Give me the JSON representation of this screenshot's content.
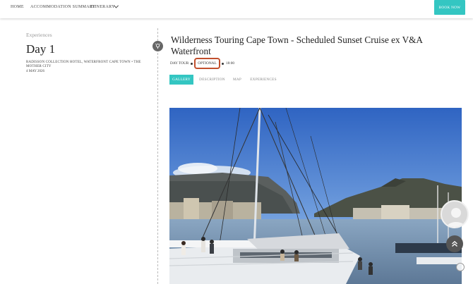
{
  "nav": {
    "home": "HOME",
    "accommodation": "ACCOMMODATION SUMMARY",
    "itinerary": "ITINERARY",
    "book_now": "BOOK NOW"
  },
  "left": {
    "section_label": "Experiences",
    "day_title": "Day 1",
    "hotel": "RADISSON COLLECTION HOTEL, WATERFRONT CAPE TOWN • THE MOTHER CITY",
    "date": "4 MAY 2026"
  },
  "event": {
    "title": "Wilderness Touring Cape Town - Scheduled Sunset Cruise ex V&A Waterfront",
    "type": "DAY TOUR",
    "optional": "OPTIONAL",
    "time": "18:00"
  },
  "tabs": [
    {
      "label": "GALLERY",
      "active": true
    },
    {
      "label": "DESCRIPTION",
      "active": false
    },
    {
      "label": "MAP",
      "active": false
    },
    {
      "label": "EXPERIENCES",
      "active": false
    }
  ],
  "colors": {
    "accent": "#34c6c2",
    "highlight_border": "#c1502e"
  },
  "icons": {
    "timeline": "map-pin-icon",
    "scroll_top": "double-chevron-up-icon",
    "avatar": "user-avatar-icon"
  }
}
